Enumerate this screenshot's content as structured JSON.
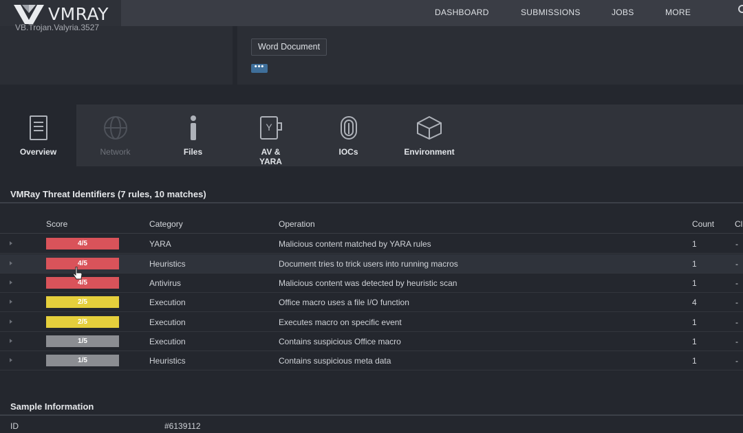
{
  "app": {
    "logo_text": "VMRAY"
  },
  "nav": {
    "items": [
      "DASHBOARD",
      "SUBMISSIONS",
      "JOBS",
      "MORE"
    ]
  },
  "header": {
    "cut_text": "VB.Trojan.Valyria.3527",
    "tag": "Word Document",
    "more_label": "•••"
  },
  "tabs": [
    {
      "label": "Overview",
      "icon": "document-icon",
      "state": "active"
    },
    {
      "label": "Network",
      "icon": "globe-icon",
      "state": "disabled"
    },
    {
      "label": "Files",
      "icon": "info-icon",
      "state": "normal"
    },
    {
      "label": "AV & YARA",
      "icon": "av-yara-icon",
      "state": "normal"
    },
    {
      "label": "IOCs",
      "icon": "fingerprint-icon",
      "state": "normal"
    },
    {
      "label": "Environment",
      "icon": "cube-icon",
      "state": "normal"
    }
  ],
  "threats": {
    "title": "VMRay Threat Identifiers (7 rules, 10 matches)",
    "columns": {
      "score": "Score",
      "category": "Category",
      "operation": "Operation",
      "count": "Count",
      "classification": "Cl"
    },
    "rows": [
      {
        "score": "4/5",
        "level": "red",
        "category": "YARA",
        "operation": "Malicious content matched by YARA rules",
        "count": "1",
        "class": "-"
      },
      {
        "score": "4/5",
        "level": "red",
        "category": "Heuristics",
        "operation": "Document tries to trick users into running macros",
        "count": "1",
        "class": "-"
      },
      {
        "score": "4/5",
        "level": "red",
        "category": "Antivirus",
        "operation": "Malicious content was detected by heuristic scan",
        "count": "1",
        "class": "-"
      },
      {
        "score": "2/5",
        "level": "yellow",
        "category": "Execution",
        "operation": "Office macro uses a file I/O function",
        "count": "4",
        "class": "-"
      },
      {
        "score": "2/5",
        "level": "yellow",
        "category": "Execution",
        "operation": "Executes macro on specific event",
        "count": "1",
        "class": "-"
      },
      {
        "score": "1/5",
        "level": "grey",
        "category": "Execution",
        "operation": "Contains suspicious Office macro",
        "count": "1",
        "class": "-"
      },
      {
        "score": "1/5",
        "level": "grey",
        "category": "Heuristics",
        "operation": "Contains suspicious meta data",
        "count": "1",
        "class": "-"
      }
    ]
  },
  "sample": {
    "title": "Sample Information",
    "id_label": "ID",
    "id_value": "#6139112"
  },
  "colors": {
    "red": "#d9535a",
    "yellow": "#e5cf3c",
    "grey": "#8b8d92",
    "accent": "#3f6f9a"
  }
}
